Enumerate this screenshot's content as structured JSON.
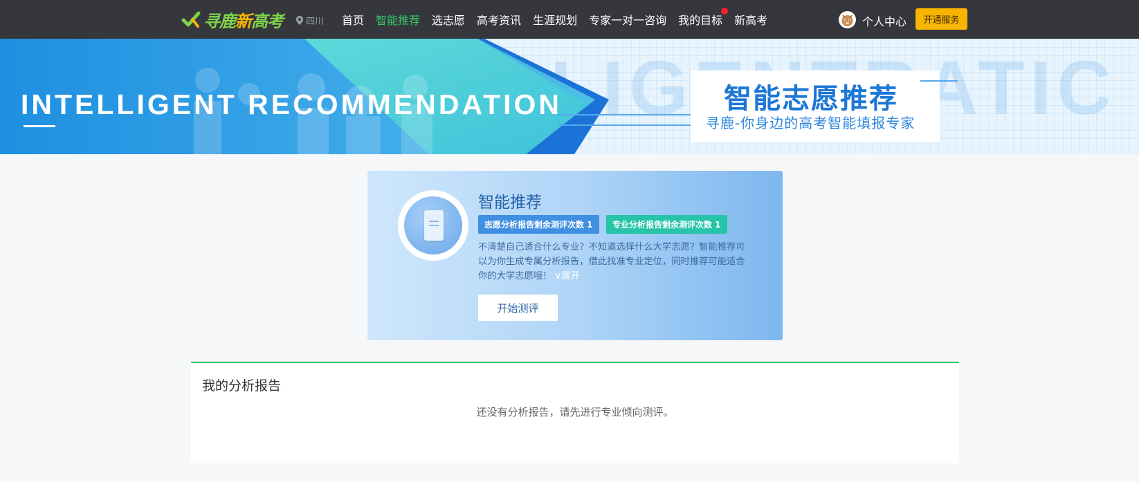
{
  "nav": {
    "logo_part1": "寻鹿",
    "logo_part2": "新",
    "logo_part3": "高考",
    "location": "四川",
    "items": [
      {
        "label": "首页",
        "active": false
      },
      {
        "label": "智能推荐",
        "active": true
      },
      {
        "label": "选志愿",
        "active": false
      },
      {
        "label": "高考资讯",
        "active": false
      },
      {
        "label": "生涯规划",
        "active": false
      },
      {
        "label": "专家一对一咨询",
        "active": false
      },
      {
        "label": "我的目标",
        "active": false,
        "dot": true
      },
      {
        "label": "新高考",
        "active": false
      }
    ],
    "user_center": "个人中心",
    "vip_button": "开通服务"
  },
  "banner": {
    "en_title": "INTELLIGENT RECOMMENDATION",
    "bg_text": "LLIGENTRATIC",
    "cn_title": "智能志愿推荐",
    "cn_subtitle": "寻鹿-你身边的高考智能填报专家"
  },
  "recommend": {
    "title": "智能推荐",
    "badge1": "志愿分析报告剩余测评次数 1",
    "badge2": "专业分析报告剩余测评次数 1",
    "description": "不清楚自己适合什么专业？不知道选择什么大学志愿？智能推荐可以为你生成专属分析报告，借此找准专业定位，同时推荐可能适合你的大学志愿哦！",
    "expand": "展开",
    "start_button": "开始测评"
  },
  "report": {
    "title": "我的分析报告",
    "empty_text": "还没有分析报告，请先进行专业倾向测评。"
  },
  "colors": {
    "nav_bg": "#35373c",
    "accent_green": "#35c46a",
    "vip_yellow": "#f7b500",
    "brand_blue": "#1b77d6"
  }
}
